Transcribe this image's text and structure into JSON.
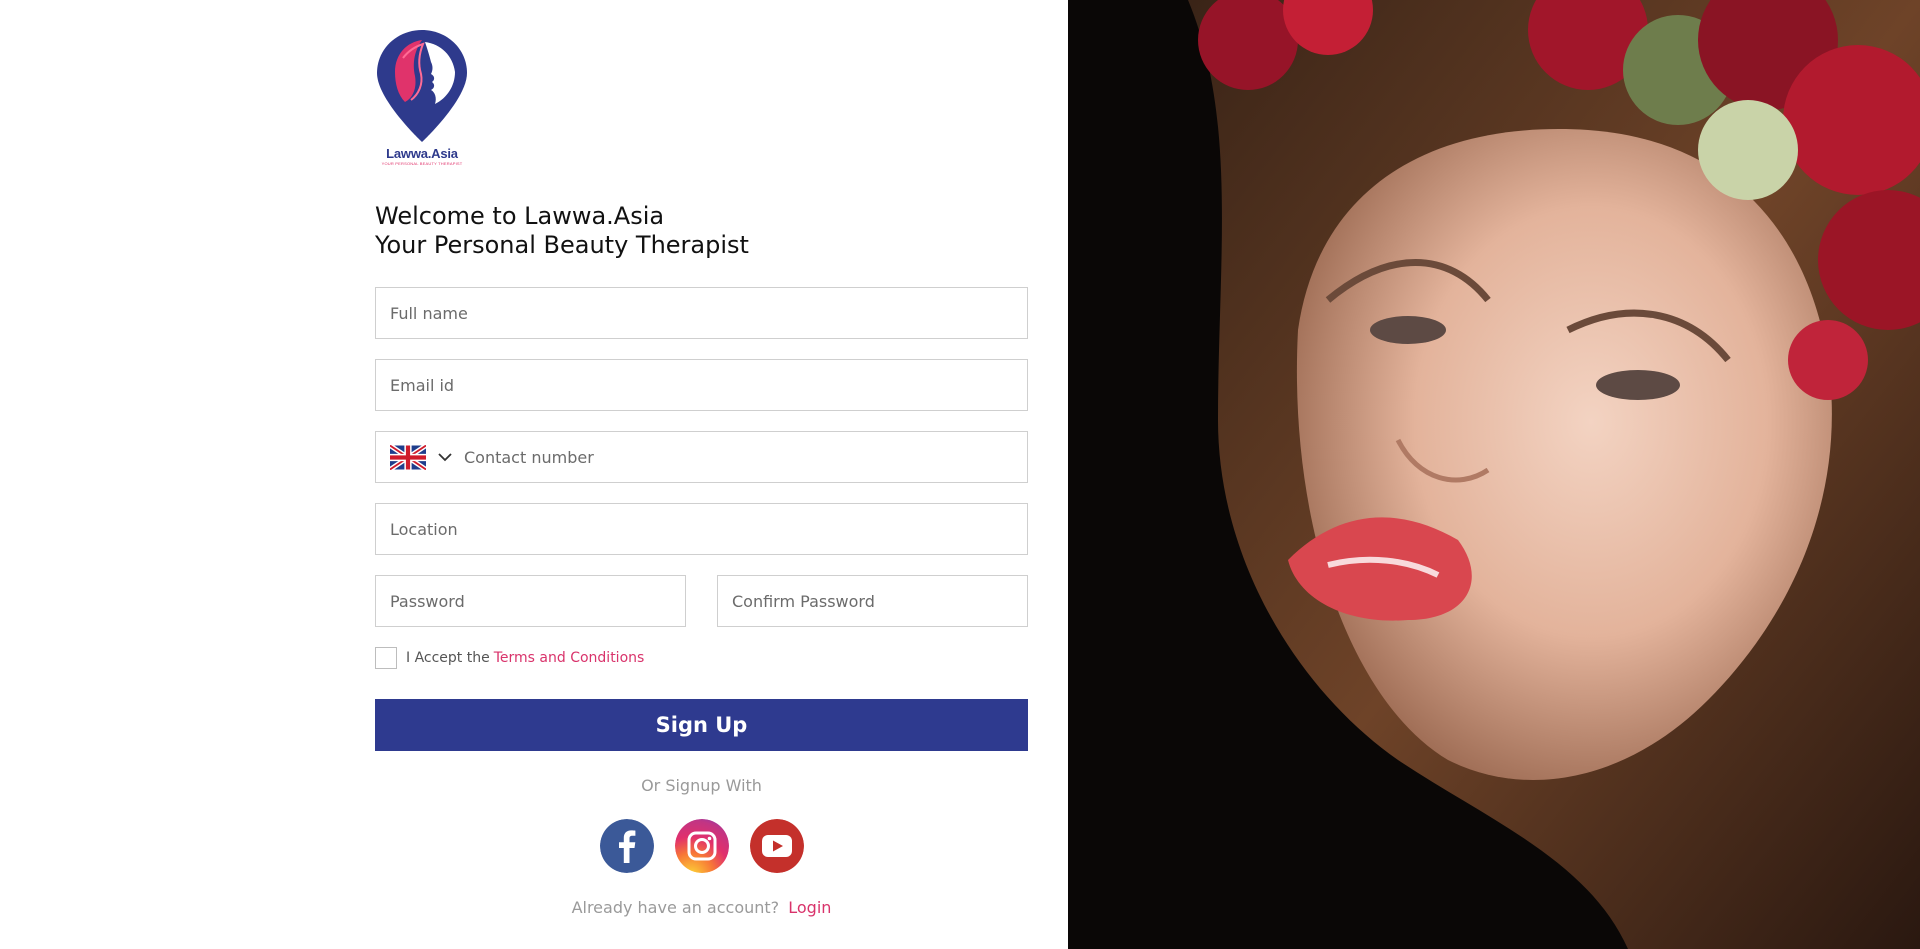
{
  "brand": {
    "name": "Lawwa.Asia",
    "tagline": "YOUR PERSONAL BEAUTY THERAPIST",
    "logo_colors": {
      "primary": "#2e3a8c",
      "accent": "#e0336b"
    }
  },
  "heading": {
    "line1": "Welcome to Lawwa.Asia",
    "line2": "Your Personal Beauty Therapist"
  },
  "form": {
    "full_name": {
      "placeholder": "Full name",
      "value": ""
    },
    "email": {
      "placeholder": "Email id",
      "value": ""
    },
    "phone": {
      "placeholder": "Contact number",
      "value": "",
      "country_flag": "uk-flag-icon"
    },
    "location": {
      "placeholder": "Location",
      "value": ""
    },
    "password": {
      "placeholder": "Password",
      "value": ""
    },
    "confirm_password": {
      "placeholder": "Confirm Password",
      "value": ""
    },
    "terms": {
      "prefix": "I Accept the",
      "link": "Terms and Conditions",
      "checked": false
    },
    "submit_label": "Sign Up"
  },
  "social": {
    "label": "Or Signup With",
    "items": [
      {
        "name": "facebook-icon",
        "color": "#3b5998"
      },
      {
        "name": "instagram-icon",
        "color": "#e1306c"
      },
      {
        "name": "youtube-icon",
        "color": "#c4302b"
      }
    ]
  },
  "login": {
    "prompt": "Already have an account?",
    "link": "Login"
  },
  "colors": {
    "primary_button": "#2e3a8f",
    "link": "#d9336b",
    "muted_text": "#9a9a9a"
  }
}
